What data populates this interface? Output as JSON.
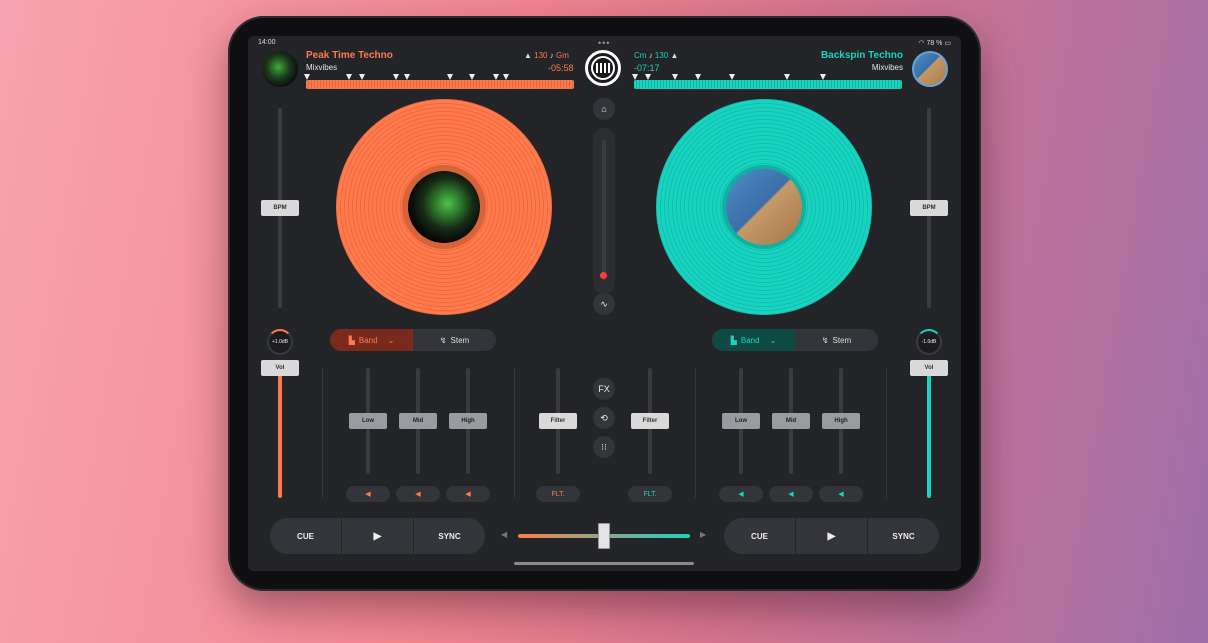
{
  "status": {
    "time": "14:00",
    "battery": "78 %"
  },
  "left_deck": {
    "title": "Peak Time Techno",
    "artist": "Mixvibes",
    "bpm": "130",
    "key": "Gm",
    "time_remaining": "-05:58",
    "pitch_label": "BPM",
    "gain": "+1.0dB",
    "volume_label": "Vol",
    "eq_mode": "Band",
    "stem_label": "Stem",
    "eq_labels": [
      "Low",
      "Mid",
      "High"
    ],
    "filter_label": "Filter",
    "filter_mode": "FLT.",
    "cue_label": "CUE",
    "sync_label": "SYNC",
    "color": "#ff7a4c"
  },
  "right_deck": {
    "title": "Backspin Techno",
    "artist": "Mixvibes",
    "bpm": "130",
    "key": "Cm",
    "time_remaining": "-07:17",
    "pitch_label": "BPM",
    "gain": "-1.0dB",
    "volume_label": "Vol",
    "eq_mode": "Band",
    "stem_label": "Stem",
    "eq_labels": [
      "Low",
      "Mid",
      "High"
    ],
    "filter_label": "Filter",
    "filter_mode": "FLT.",
    "cue_label": "CUE",
    "sync_label": "SYNC",
    "color": "#18d3c0"
  },
  "center": {
    "fx_label": "FX",
    "icons": [
      "home-icon",
      "waveform-icon",
      "loop-icon",
      "grid-icon",
      "record-icon"
    ]
  },
  "icons": {
    "bpm": "metronome-icon",
    "key": "music-note-icon",
    "play": "play-icon",
    "eq": "band-eq-icon",
    "stem": "stem-icon",
    "wifi": "wifi-icon",
    "battery": "battery-icon"
  }
}
